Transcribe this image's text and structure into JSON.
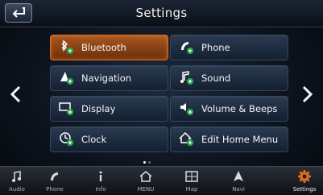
{
  "header": {
    "title": "Settings",
    "back_icon": "back-arrow-icon"
  },
  "navigation": {
    "prev_icon": "chevron-left-icon",
    "next_icon": "chevron-right-icon"
  },
  "menu": {
    "items": [
      {
        "label": "Bluetooth",
        "icon": "bluetooth-gear-icon",
        "selected": true
      },
      {
        "label": "Phone",
        "icon": "phone-gear-icon",
        "selected": false
      },
      {
        "label": "Navigation",
        "icon": "navigation-gear-icon",
        "selected": false
      },
      {
        "label": "Sound",
        "icon": "music-note-gear-icon",
        "selected": false
      },
      {
        "label": "Display",
        "icon": "display-gear-icon",
        "selected": false
      },
      {
        "label": "Volume & Beeps",
        "icon": "speaker-gear-icon",
        "selected": false
      },
      {
        "label": "Clock",
        "icon": "clock-gear-icon",
        "selected": false
      },
      {
        "label": "Edit Home Menu",
        "icon": "home-gear-icon",
        "selected": false
      }
    ]
  },
  "pagination": {
    "current_page": 1,
    "total_pages": 2
  },
  "bottom_bar": {
    "tabs": [
      {
        "label": "Audio",
        "icon": "music-note-icon",
        "active": false
      },
      {
        "label": "Phone",
        "icon": "phone-icon",
        "active": false
      },
      {
        "label": "Info",
        "icon": "info-icon",
        "active": false
      },
      {
        "label": "MENU",
        "icon": "home-icon",
        "active": false
      },
      {
        "label": "Map",
        "icon": "map-icon",
        "active": false
      },
      {
        "label": "Navi",
        "icon": "navigation-arrow-icon",
        "active": false
      },
      {
        "label": "Settings",
        "icon": "gear-icon",
        "active": true
      }
    ]
  },
  "colors": {
    "accent": "#e06a1d",
    "tile": "#1d2a3c",
    "background": "#0c121c"
  }
}
